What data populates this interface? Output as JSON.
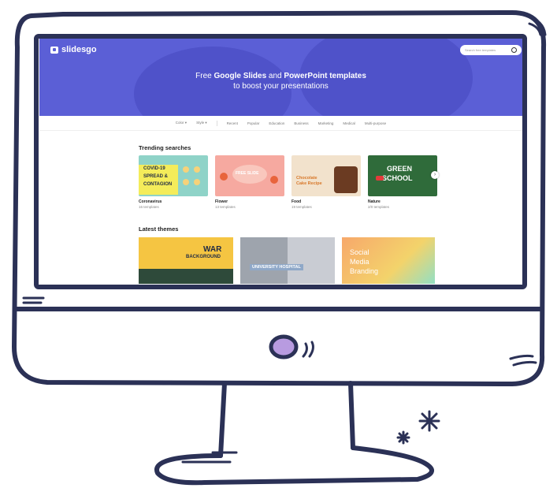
{
  "site": {
    "logo_text": "slidesgo",
    "search_placeholder": "Search free templates",
    "hero_line1_a": "Free ",
    "hero_line1_b": "Google Slides",
    "hero_line1_c": " and ",
    "hero_line1_d": "PowerPoint templates",
    "hero_line2": "to boost your presentations"
  },
  "nav": {
    "items": [
      "Color ▾",
      "Style ▾",
      "Recent",
      "Popular",
      "Education",
      "Business",
      "Marketing",
      "Medical",
      "Multi-purpose"
    ]
  },
  "trending": {
    "title": "Trending searches",
    "cards": [
      {
        "name": "Coronavirus",
        "count": "16 templates",
        "thumb_text_1": "COVID-19",
        "thumb_text_2": "SPREAD &",
        "thumb_text_3": "CONTAGION",
        "accent": "#8fd3c8"
      },
      {
        "name": "Flower",
        "count": "13 templates",
        "thumb_text_1": "FREE SLIDE",
        "accent": "#f6a9a0"
      },
      {
        "name": "Food",
        "count": "19 templates",
        "thumb_text_1": "Chocolate",
        "thumb_text_2": "Cake Recipe",
        "accent": "#f2e2cc"
      },
      {
        "name": "Nature",
        "count": "2/0 templates",
        "thumb_text_1": "GREEN",
        "thumb_text_2": "SCHOOL",
        "accent": "#2f6b3a"
      }
    ]
  },
  "latest": {
    "title": "Latest themes",
    "themes": [
      {
        "text_1": "WAR",
        "text_2": "BACKGROUND",
        "accent": "#f5c542"
      },
      {
        "text_1": "UNIVERSITY HOSPITAL",
        "accent": "#8fa8c8"
      },
      {
        "text_1": "Social",
        "text_2": "Media",
        "text_3": "Branding",
        "accent": "#f7a86b"
      }
    ]
  },
  "colors": {
    "hero": "#5b5fd6",
    "frame": "#2b3156",
    "camera": "#b89be0"
  }
}
